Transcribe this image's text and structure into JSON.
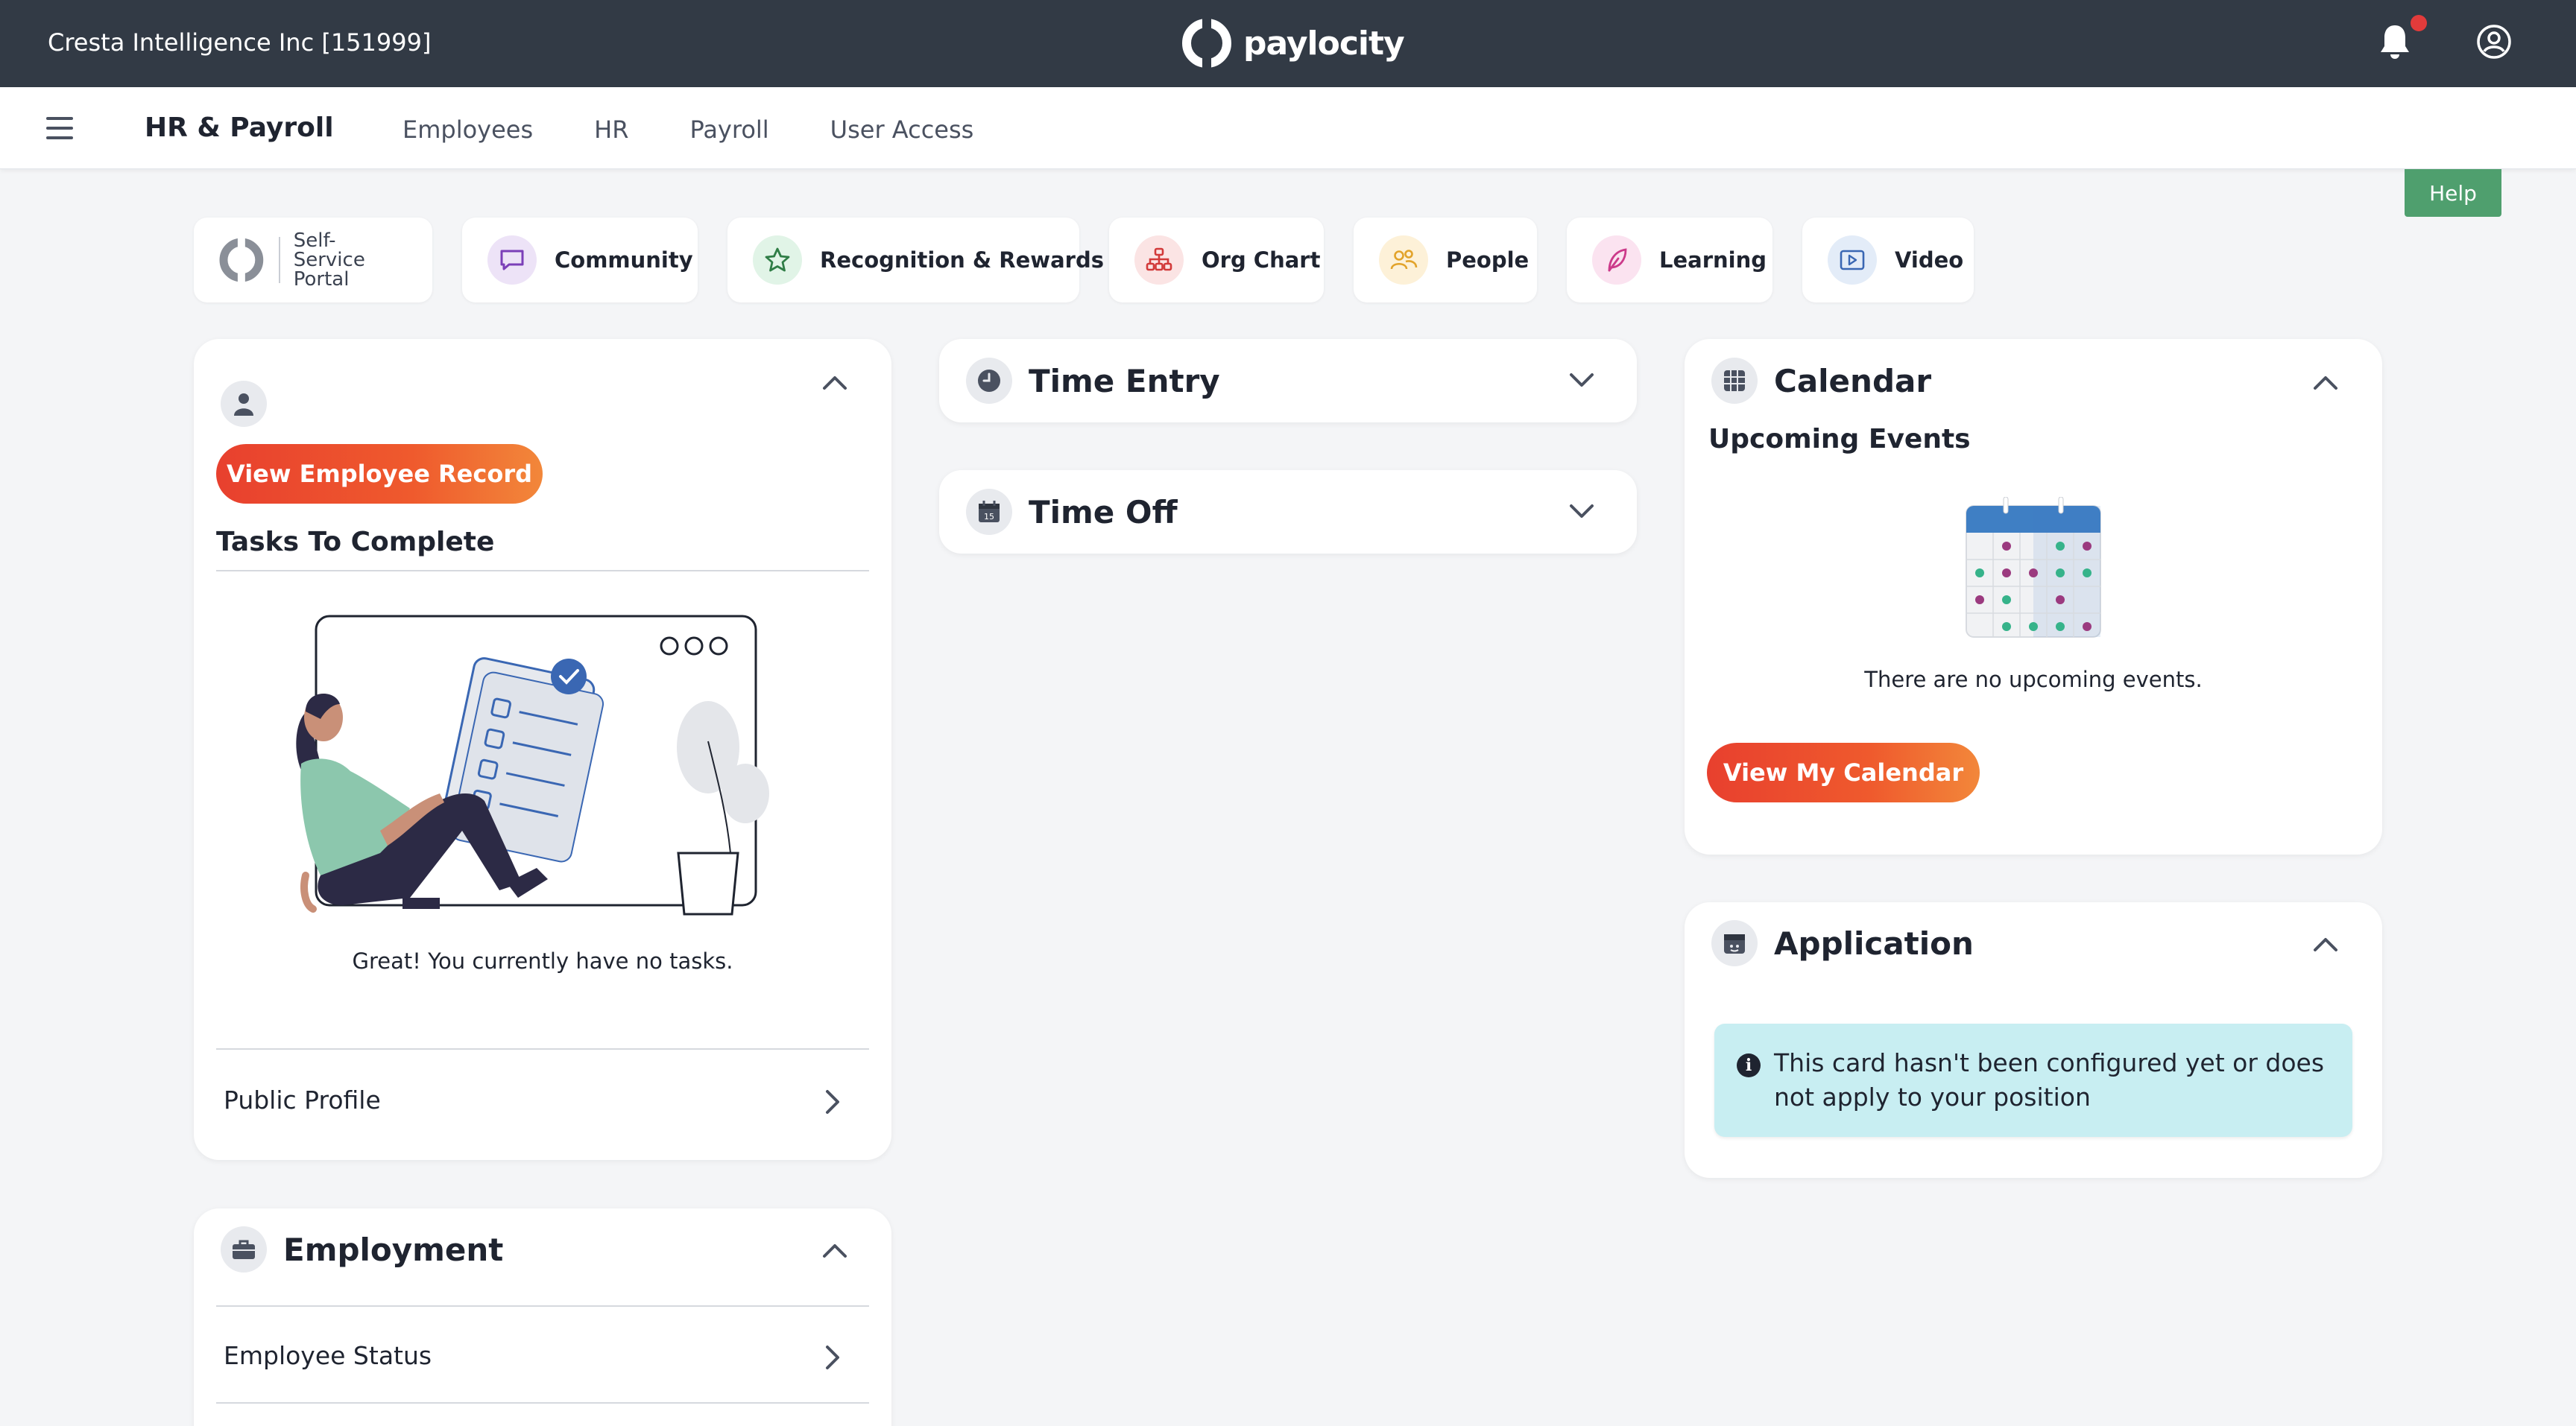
{
  "topbar": {
    "company": "Cresta Intelligence Inc [151999]",
    "logo_text": "paylocity"
  },
  "navbar": {
    "title": "HR & Payroll",
    "links": [
      "Employees",
      "HR",
      "Payroll",
      "User Access"
    ]
  },
  "help_label": "Help",
  "quick_links": {
    "self_service_line1": "Self-Service",
    "self_service_line2": "Portal",
    "community": "Community",
    "recognition": "Recognition & Rewards",
    "org_chart": "Org Chart",
    "people": "People",
    "learning": "Learning",
    "video": "Video"
  },
  "profile_card": {
    "view_record": "View Employee Record",
    "tasks_title": "Tasks To Complete",
    "no_tasks": "Great! You currently have no tasks.",
    "public_profile": "Public Profile"
  },
  "employment_card": {
    "title": "Employment",
    "employee_status": "Employee Status"
  },
  "time_entry": {
    "title": "Time Entry"
  },
  "time_off": {
    "title": "Time Off",
    "icon_day": "15"
  },
  "calendar_card": {
    "title": "Calendar",
    "subtitle": "Upcoming Events",
    "empty": "There are no upcoming events.",
    "button": "View My Calendar"
  },
  "application_card": {
    "title": "Application",
    "message": "This card hasn't been configured yet or does not apply to your position"
  },
  "colors": {
    "topbar": "#323a45",
    "accent_start": "#e8402e",
    "accent_end": "#f2873a",
    "help": "#4f9f6e",
    "info_bg": "#c8eef2"
  }
}
